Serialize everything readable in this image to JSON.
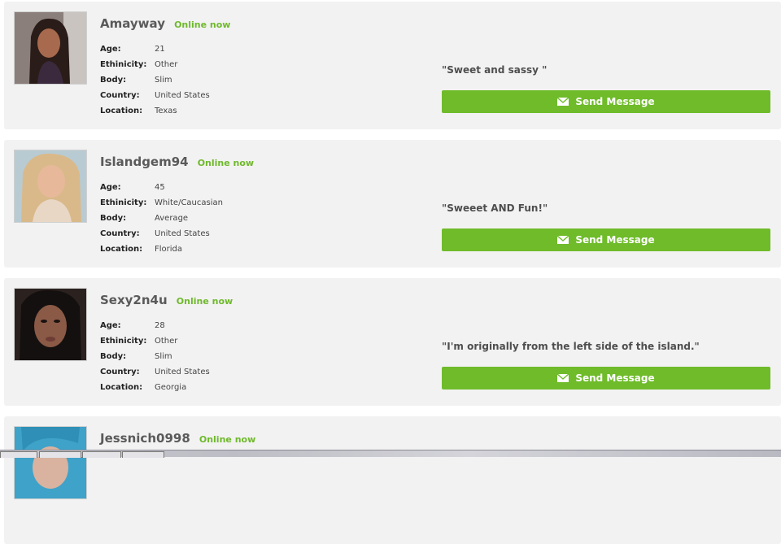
{
  "profiles": [
    {
      "name": "Amayway",
      "status": "Online now",
      "age_label": "Age:",
      "age": "21",
      "ethnicity_label": "Ethinicity:",
      "ethnicity": "Other",
      "body_label": "Body:",
      "body": "Slim",
      "country_label": "Country:",
      "country": "United States",
      "location_label": "Location:",
      "location": "Texas",
      "quote": "\"Sweet and sassy \"",
      "button_label": "Send Message"
    },
    {
      "name": "Islandgem94",
      "status": "Online now",
      "age_label": "Age:",
      "age": "45",
      "ethnicity_label": "Ethinicity:",
      "ethnicity": "White/Caucasian",
      "body_label": "Body:",
      "body": "Average",
      "country_label": "Country:",
      "country": "United States",
      "location_label": "Location:",
      "location": "Florida",
      "quote": "\"Sweeet AND Fun!\"",
      "button_label": "Send Message"
    },
    {
      "name": "Sexy2n4u",
      "status": "Online now",
      "age_label": "Age:",
      "age": "28",
      "ethnicity_label": "Ethinicity:",
      "ethnicity": "Other",
      "body_label": "Body:",
      "body": "Slim",
      "country_label": "Country:",
      "country": "United States",
      "location_label": "Location:",
      "location": "Georgia",
      "quote": "\"I'm originally from the left side of the island.\"",
      "button_label": "Send Message"
    },
    {
      "name": "Jessnich0998",
      "status": "Online now"
    }
  ],
  "colors": {
    "accent_green": "#6fbb2a",
    "online_green": "#6fb92c",
    "card_bg": "#f2f2f2"
  },
  "icons": {
    "button_icon": "envelope-icon",
    "photo": "profile-photo"
  }
}
